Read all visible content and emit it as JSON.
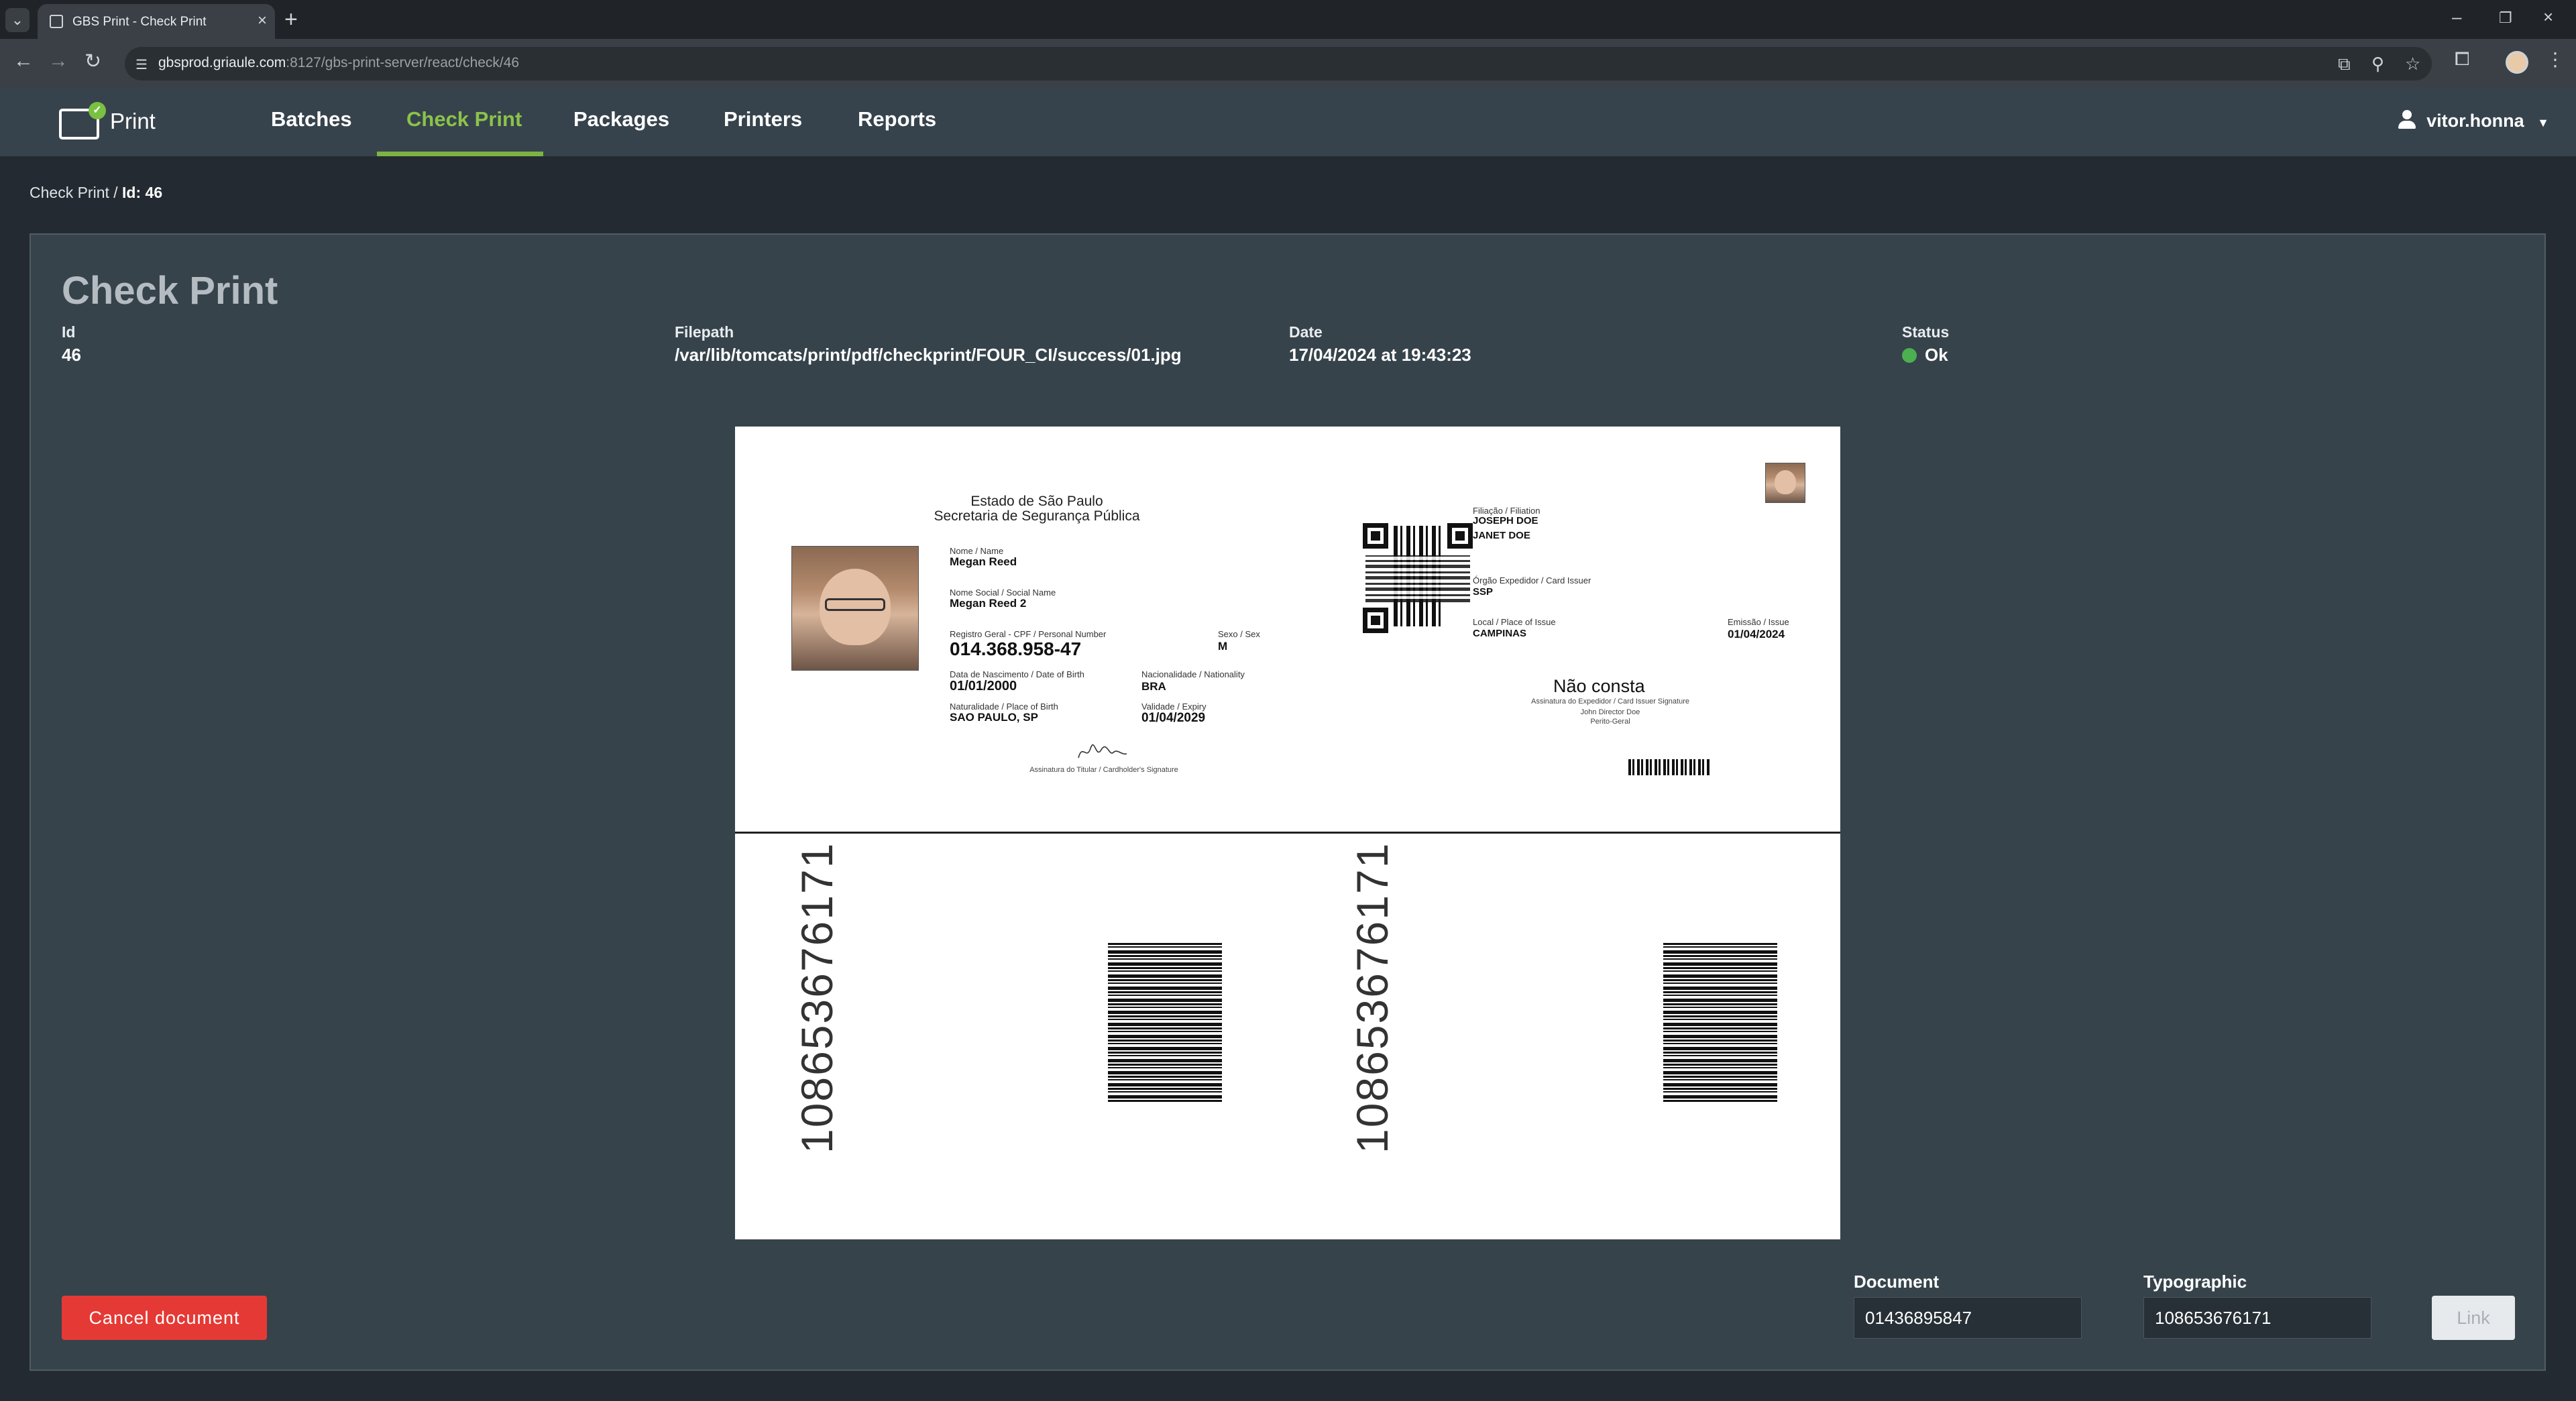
{
  "browser": {
    "tab_title": "GBS Print - Check Print",
    "url_host": "gbsprod.griaule.com",
    "url_rest": ":8127/gbs-print-server/react/check/46"
  },
  "app": {
    "logo_text": "Print",
    "nav": [
      "Batches",
      "Check Print",
      "Packages",
      "Printers",
      "Reports"
    ],
    "active_nav": "Check Print",
    "user": "vitor.honna"
  },
  "breadcrumb": {
    "parent": "Check Print",
    "separator": "/",
    "current": "Id: 46"
  },
  "check": {
    "title": "Check Print",
    "id_label": "Id",
    "id_value": "46",
    "filepath_label": "Filepath",
    "filepath_value": "/var/lib/tomcats/print/pdf/checkprint/FOUR_CI/success/01.jpg",
    "date_label": "Date",
    "date_value": "17/04/2024 at 19:43:23",
    "status_label": "Status",
    "status_value": "Ok",
    "status_color": "#4caf50"
  },
  "card": {
    "issuer_line1": "Estado de São Paulo",
    "issuer_line2": "Secretaria de Segurança Pública",
    "name_label": "Nome / Name",
    "name_value": "Megan Reed",
    "social_label": "Nome Social / Social Name",
    "social_value": "Megan Reed 2",
    "cpf_label": "Registro Geral - CPF / Personal Number",
    "cpf_value": "014.368.958-47",
    "sex_label": "Sexo / Sex",
    "sex_value": "M",
    "dob_label": "Data de Nascimento / Date of Birth",
    "dob_value": "01/01/2000",
    "nationality_label": "Nacionalidade / Nationality",
    "nationality_value": "BRA",
    "pob_label": "Naturalidade / Place of Birth",
    "pob_value": "SAO PAULO, SP",
    "expiry_label": "Validade / Expiry",
    "expiry_value": "01/04/2029",
    "holder_sig_label": "Assinatura do Titular / Cardholder's Signature",
    "filiation_label": "Filiação / Filiation",
    "filiation_1": "JOSEPH DOE",
    "filiation_2": "JANET DOE",
    "card_issuer_label": "Órgão Expedidor / Card Issuer",
    "card_issuer_value": "SSP",
    "place_issue_label": "Local / Place of Issue",
    "place_issue_value": "CAMPINAS",
    "issue_label": "Emissão / Issue",
    "issue_value": "01/04/2024",
    "nao_consta": "Não consta",
    "issuer_sig_label": "Assinatura do Expedidor / Card Issuer Signature",
    "issuer_name": "John Director Doe",
    "issuer_role": "Perito-Geral",
    "barcode_number_1": "108653676171",
    "barcode_number_2": "108653676171"
  },
  "form": {
    "cancel_label": "Cancel document",
    "document_label": "Document",
    "document_value": "01436895847",
    "typographic_label": "Typographic",
    "typographic_value": "108653676171",
    "link_label": "Link"
  }
}
